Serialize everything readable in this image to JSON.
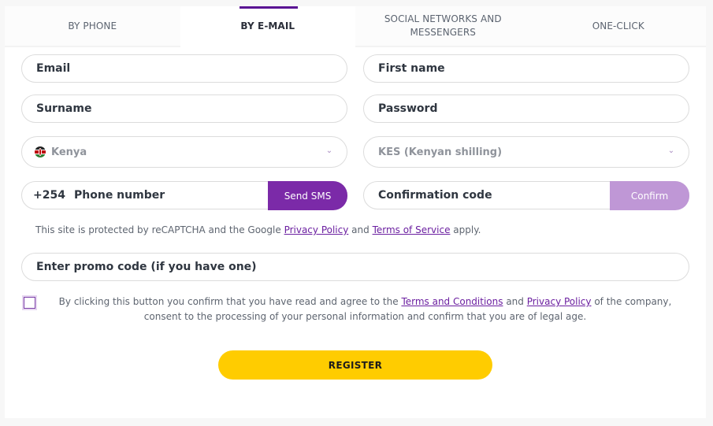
{
  "tabs": [
    {
      "label": "BY PHONE",
      "active": false
    },
    {
      "label": "BY E-MAIL",
      "active": true
    },
    {
      "label": "SOCIAL NETWORKS AND MESSENGERS",
      "active": false
    },
    {
      "label": "ONE-CLICK",
      "active": false
    }
  ],
  "form": {
    "email_placeholder": "Email",
    "first_name_placeholder": "First name",
    "surname_placeholder": "Surname",
    "password_placeholder": "Password",
    "country": {
      "value": "Kenya",
      "icon": "kenya-flag-icon"
    },
    "currency": {
      "value": "KES (Kenyan shilling)"
    },
    "phone": {
      "prefix": "+254",
      "placeholder": "Phone number",
      "send_sms_label": "Send SMS"
    },
    "confirmation": {
      "placeholder": "Confirmation code",
      "confirm_label": "Confirm"
    },
    "promo_placeholder": "Enter promo code (if you have one)"
  },
  "recaptcha": {
    "prefix": "This site is protected by reCAPTCHA and the Google ",
    "privacy_link": "Privacy Policy",
    "middle": " and ",
    "terms_link": "Terms of Service",
    "suffix": " apply."
  },
  "consent": {
    "checked": false,
    "prefix": "By clicking this button you confirm that you have read and agree to the ",
    "terms_link": "Terms and Conditions",
    "middle": " and ",
    "privacy_link": "Privacy Policy",
    "suffix": " of the company, consent to the processing of your personal information and confirm that you are of legal age."
  },
  "register_label": "REGISTER",
  "colors": {
    "accent_purple": "#7b2aa8",
    "confirm_disabled": "#bf97d6",
    "register_yellow": "#ffcc00",
    "link": "#6b1fa0"
  }
}
